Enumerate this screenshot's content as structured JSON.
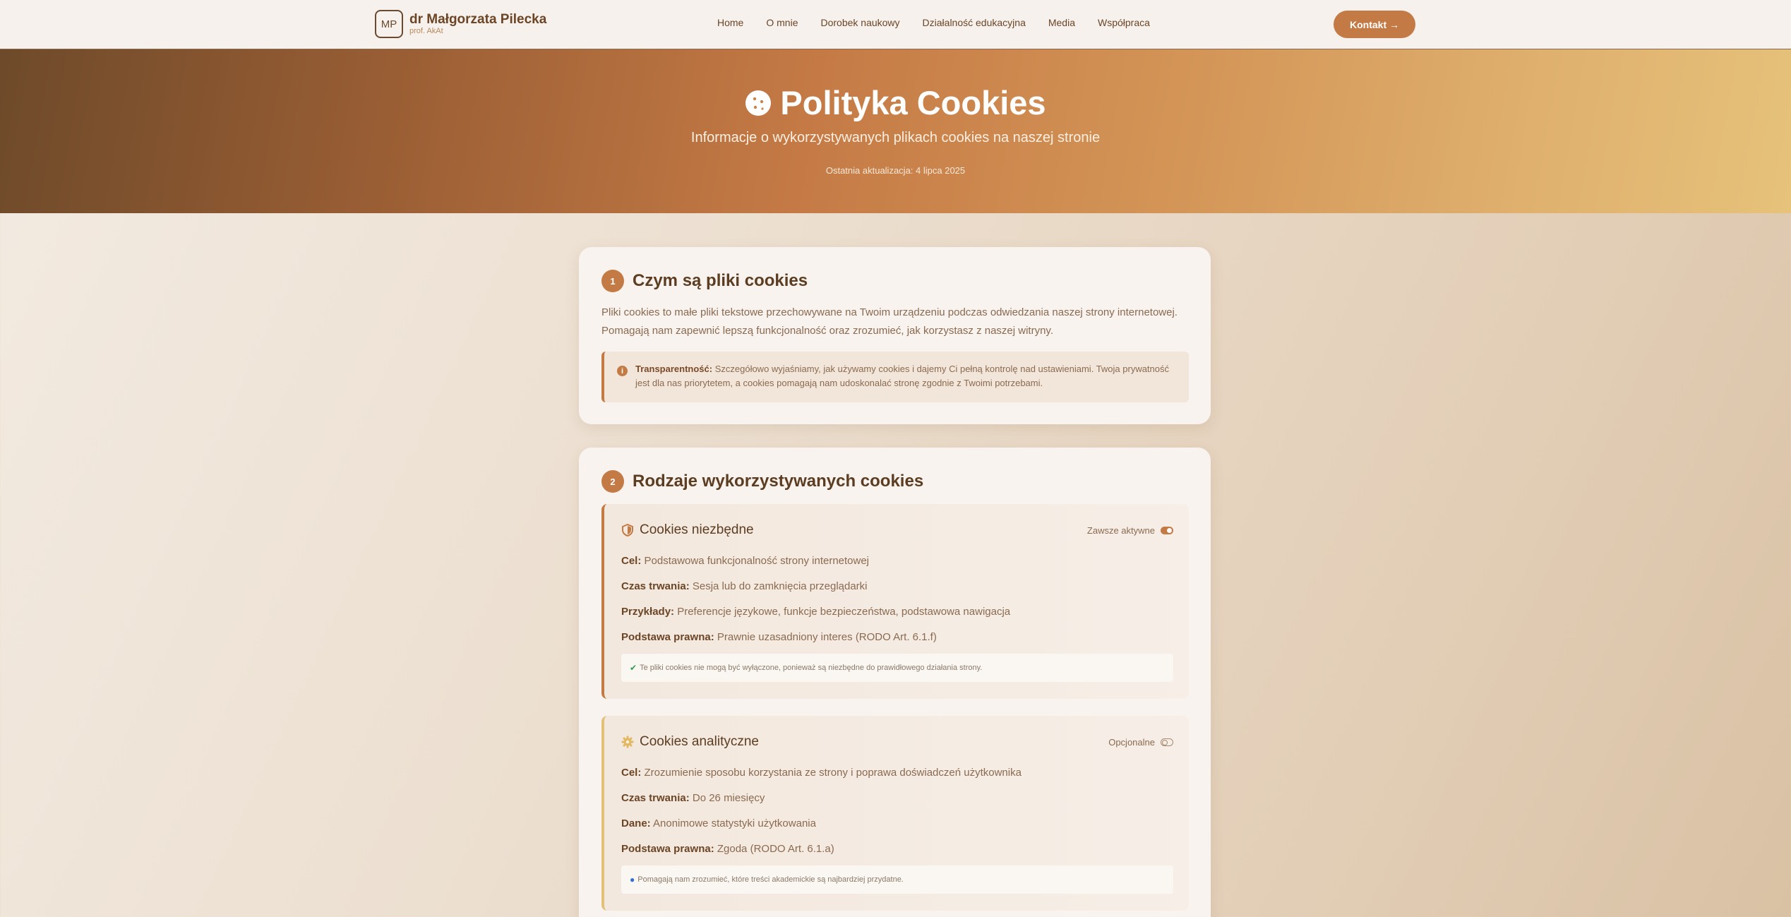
{
  "nav": {
    "logo_initials": "MP",
    "name": "dr Małgorzata Pilecka",
    "subtitle": "prof. AkAt",
    "items": [
      {
        "label": "Home"
      },
      {
        "label": "O mnie"
      },
      {
        "label": "Dorobek naukowy"
      },
      {
        "label": "Działalność edukacyjna"
      },
      {
        "label": "Media"
      },
      {
        "label": "Współpraca"
      }
    ],
    "contact_label": "Kontakt →"
  },
  "hero": {
    "title": "Polityka Cookies",
    "subtitle": "Informacje o wykorzystywanych plikach cookies na naszej stronie",
    "updated": "Ostatnia aktualizacja: 4 lipca 2025",
    "icon": "cookie-icon"
  },
  "sections": [
    {
      "number": "1",
      "title": "Czym są pliki cookies",
      "text": "Pliki cookies to małe pliki tekstowe przechowywane na Twoim urządzeniu podczas odwiedzania naszej strony internetowej. Pomagają nam zapewnić lepszą funkcjonalność oraz zrozumieć, jak korzystasz z naszej witryny.",
      "notice_label": "Transparentność:",
      "notice_text": " Szczegółowo wyjaśniamy, jak używamy cookies i dajemy Ci pełną kontrolę nad ustawieniami. Twoja prywatność jest dla nas priorytetem, a cookies pomagają nam udoskonalać stronę zgodnie z Twoimi potrzebami."
    },
    {
      "number": "2",
      "title": "Rodzaje wykorzystywanych cookies",
      "types": [
        {
          "title": "Cookies niezbędne",
          "icon": "shield-icon",
          "status": "Zawsze aktywne",
          "toggle": true,
          "rows": [
            {
              "label": "Cel:",
              "value": " Podstawowa funkcjonalność strony internetowej"
            },
            {
              "label": "Czas trwania:",
              "value": " Sesja lub do zamknięcia przeglądarki"
            },
            {
              "label": "Przykłady:",
              "value": " Preferencje językowe, funkcje bezpieczeństwa, podstawowa nawigacja"
            },
            {
              "label": "Podstawa prawna:",
              "value": " Prawnie uzasadniony interes (RODO Art. 6.1.f)"
            }
          ],
          "note_icon": "check-icon",
          "note": "Te pliki cookies nie mogą być wyłączone, ponieważ są niezbędne do prawidłowego działania strony."
        },
        {
          "title": "Cookies analityczne",
          "icon": "gear-icon",
          "status": "Opcjonalne",
          "toggle": false,
          "rows": [
            {
              "label": "Cel:",
              "value": " Zrozumienie sposobu korzystania ze strony i poprawa doświadczeń użytkownika"
            },
            {
              "label": "Czas trwania:",
              "value": " Do 26 miesięcy"
            },
            {
              "label": "Dane:",
              "value": " Anonimowe statystyki użytkowania"
            },
            {
              "label": "Podstawa prawna:",
              "value": " Zgoda (RODO Art. 6.1.a)"
            }
          ],
          "note_icon": "info-icon",
          "note": "Pomagają nam zrozumieć, które treści akademickie są najbardziej przydatne."
        }
      ]
    }
  ],
  "colors": {
    "accent": "#c47a44",
    "accent_light": "#e2c27a",
    "text_dark": "#5c3d22",
    "text_muted": "#8a6a50"
  }
}
